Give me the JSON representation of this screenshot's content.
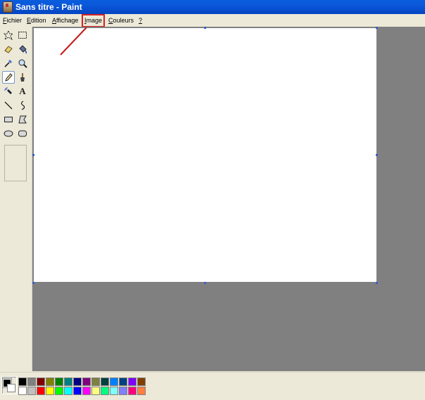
{
  "window": {
    "title": "Sans titre - Paint",
    "icon": "paint-app-icon"
  },
  "menu": {
    "items": [
      {
        "label": "Fichier",
        "accel": "F",
        "rest": "ichier"
      },
      {
        "label": "Edition",
        "accel": "E",
        "rest": "dition"
      },
      {
        "label": "Affichage",
        "accel": "A",
        "rest": "ffichage"
      },
      {
        "label": "Image",
        "accel": "I",
        "rest": "mage"
      },
      {
        "label": "Couleurs",
        "accel": "C",
        "rest": "ouleurs"
      },
      {
        "label": "?",
        "accel": "?",
        "rest": ""
      }
    ],
    "highlighted": "Image",
    "highlight_color": "#d4201f"
  },
  "tools": [
    {
      "name": "free-form-select-icon"
    },
    {
      "name": "rect-select-icon"
    },
    {
      "name": "eraser-icon"
    },
    {
      "name": "fill-bucket-icon"
    },
    {
      "name": "color-picker-icon"
    },
    {
      "name": "magnifier-icon"
    },
    {
      "name": "pencil-icon",
      "active": true
    },
    {
      "name": "brush-icon"
    },
    {
      "name": "airbrush-icon"
    },
    {
      "name": "text-icon"
    },
    {
      "name": "line-icon"
    },
    {
      "name": "curve-icon"
    },
    {
      "name": "rectangle-icon"
    },
    {
      "name": "polygon-icon"
    },
    {
      "name": "ellipse-icon"
    },
    {
      "name": "rounded-rect-icon"
    }
  ],
  "colors": {
    "foreground": "#000000",
    "background": "#ffffff",
    "top_row": [
      "#000000",
      "#808080",
      "#800000",
      "#808000",
      "#008000",
      "#008080",
      "#000080",
      "#800080",
      "#808040",
      "#004040",
      "#0080ff",
      "#004080",
      "#8000ff",
      "#804000"
    ],
    "bottom_row": [
      "#ffffff",
      "#c0c0c0",
      "#ff0000",
      "#ffff00",
      "#00ff00",
      "#00ffff",
      "#0000ff",
      "#ff00ff",
      "#ffff80",
      "#00ff80",
      "#80ffff",
      "#8080ff",
      "#ff0080",
      "#ff8040"
    ]
  }
}
